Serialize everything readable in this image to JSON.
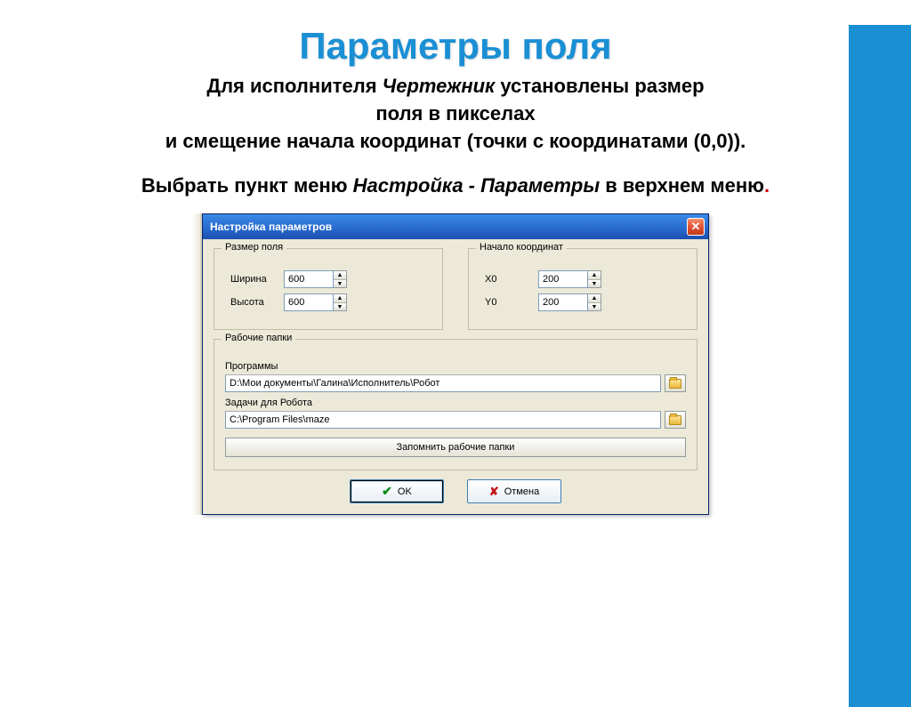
{
  "slide": {
    "title": "Параметры поля",
    "body_line1_a": "Для исполнителя ",
    "body_line1_b": "Чертежник",
    "body_line1_c": "  установлены размер",
    "body_line2": "поля в пикселах",
    "body_line3": "и смещение начала координат (точки с координатами (0,0)).",
    "instr_a": "Выбрать пункт меню ",
    "instr_b": "Настройка - Параметры",
    "instr_c": " в верхнем меню",
    "instr_dot": "."
  },
  "dialog": {
    "title": "Настройка параметров",
    "group_size": "Размер поля",
    "group_origin": "Начало координат",
    "width_label": "Ширина",
    "height_label": "Высота",
    "x0_label": "X0",
    "y0_label": "Y0",
    "width_value": "600",
    "height_value": "600",
    "x0_value": "200",
    "y0_value": "200",
    "group_folders": "Рабочие папки",
    "programs_label": "Программы",
    "programs_path": "D:\\Мои документы\\Галина\\Исполнитель\\Робот",
    "tasks_label": "Задачи для Робота",
    "tasks_path": "C:\\Program Files\\maze",
    "remember_btn": "Запомнить рабочие папки",
    "ok_btn": "OK",
    "cancel_btn": "Отмена"
  }
}
